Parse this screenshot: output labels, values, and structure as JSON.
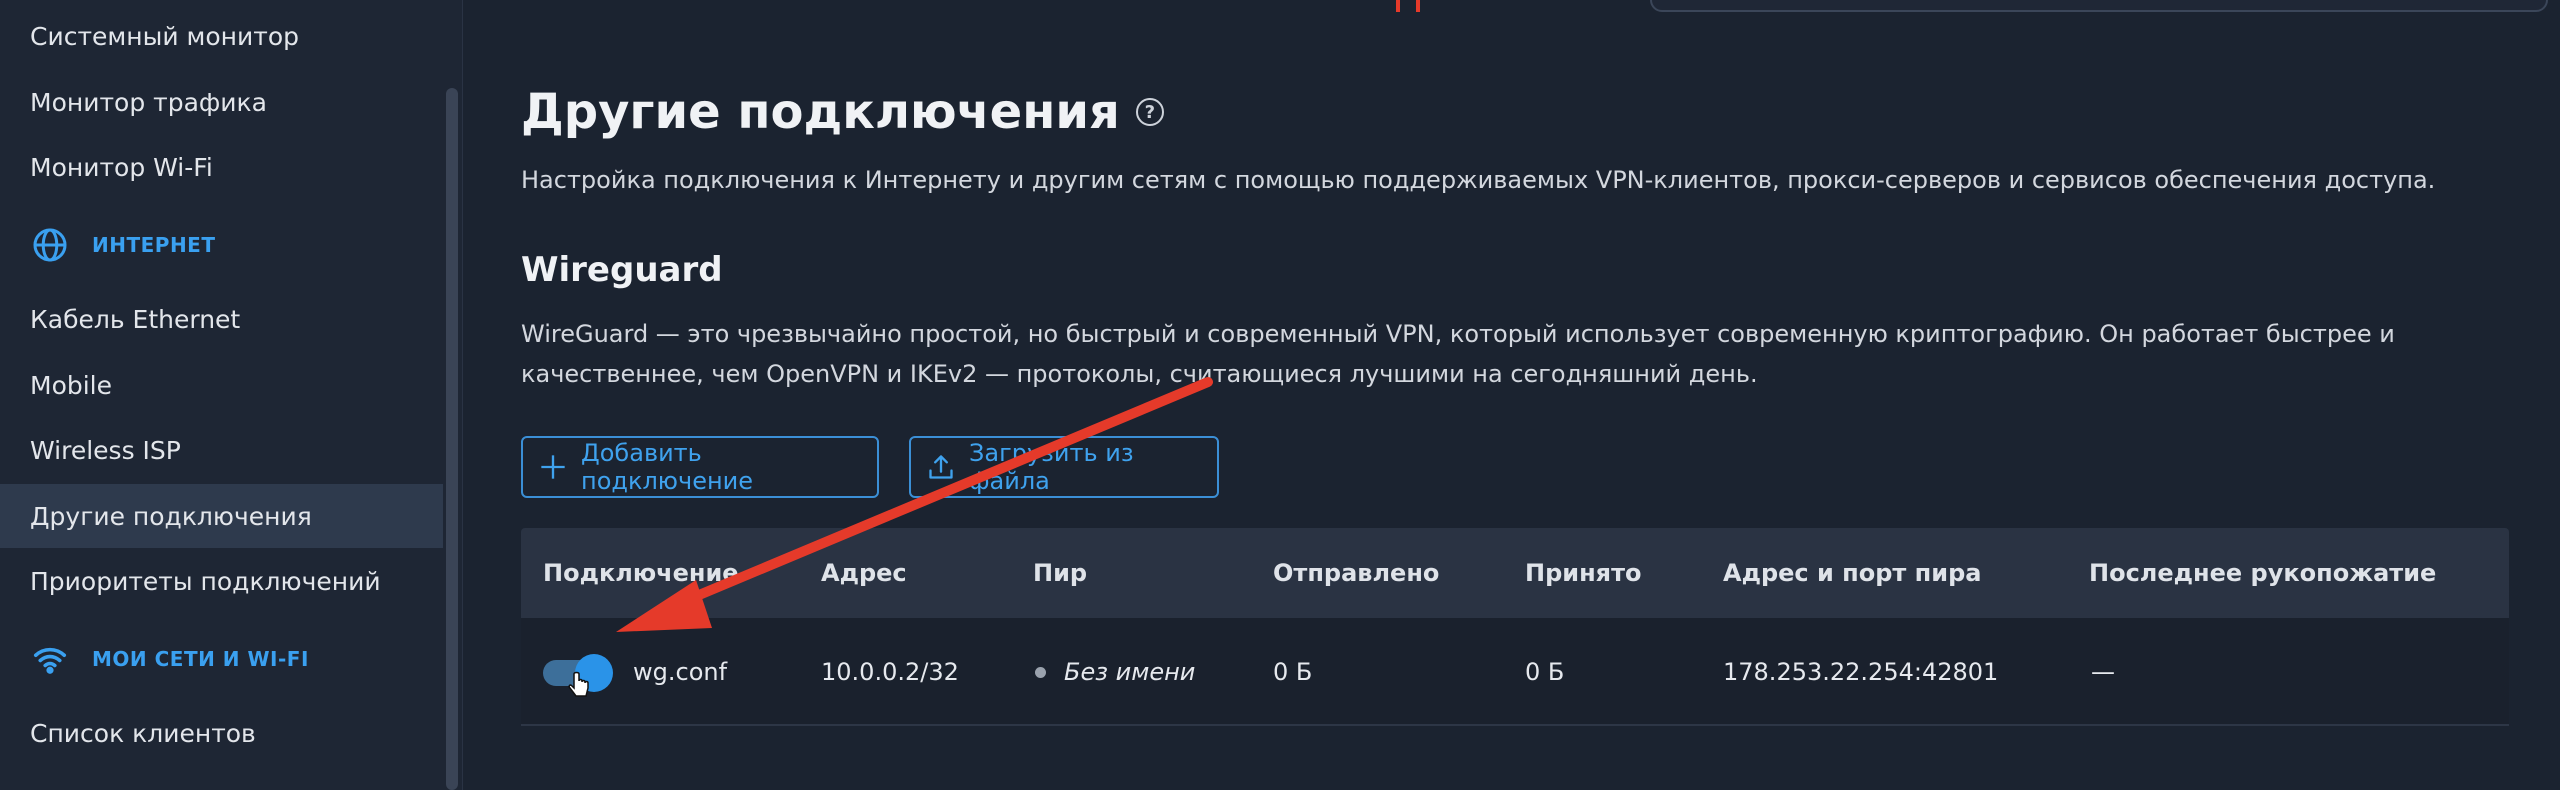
{
  "sidebar": {
    "items": [
      {
        "label": "Системный монитор"
      },
      {
        "label": "Монитор трафика"
      },
      {
        "label": "Монитор Wi-Fi"
      },
      {
        "label": "Кабель Ethernet"
      },
      {
        "label": "Mobile"
      },
      {
        "label": "Wireless ISP"
      },
      {
        "label": "Другие подключения",
        "active": true
      },
      {
        "label": "Приоритеты подключений"
      },
      {
        "label": "Список клиентов"
      }
    ],
    "sections": [
      {
        "label": "ИНТЕРНЕТ",
        "icon": "globe-icon"
      },
      {
        "label": "МОИ СЕТИ И WI-FI",
        "icon": "wifi-icon"
      }
    ]
  },
  "page": {
    "title": "Другие подключения",
    "help_icon": "?",
    "description": "Настройка подключения к Интернету и другим сетям с помощью поддерживаемых VPN-клиентов, прокси-серверов и сервисов обеспечения доступа."
  },
  "wireguard": {
    "title": "Wireguard",
    "description": "WireGuard — это чрезвычайно простой, но быстрый и современный VPN, который использует современную криптографию. Он работает быстрее и качественнее, чем OpenVPN и IKEv2 — протоколы, считающиеся лучшими на сегодняшний день.",
    "add_button": "Добавить подключение",
    "upload_button": "Загрузить из файла",
    "table": {
      "headers": [
        "Подключение",
        "Адрес",
        "Пир",
        "Отправлено",
        "Принято",
        "Адрес и порт пира",
        "Последнее рукопожатие"
      ],
      "rows": [
        {
          "enabled": true,
          "connection": "wg.conf",
          "address": "10.0.0.2/32",
          "peer": "Без имени",
          "sent": "0 Б",
          "received": "0 Б",
          "peer_endpoint": "178.253.22.254:42801",
          "last_handshake": "—"
        }
      ]
    }
  },
  "colors": {
    "accent": "#3aa0f0",
    "annotation_arrow": "#e53a2a",
    "background": "#1b2330",
    "sidebar_active": "#2e3a4d"
  }
}
